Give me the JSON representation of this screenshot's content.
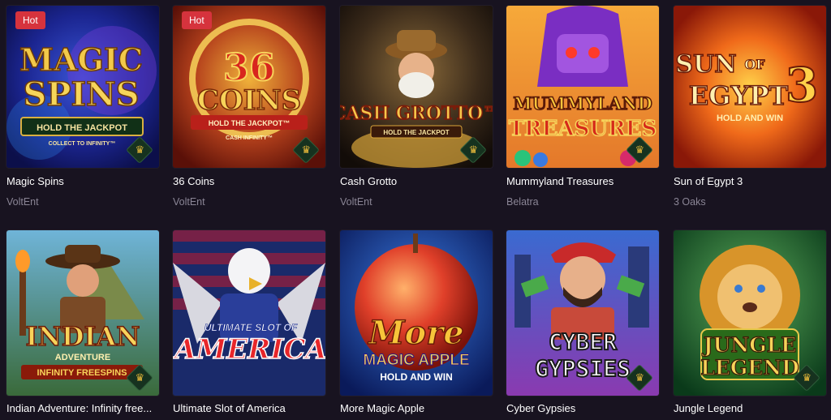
{
  "colors": {
    "background": "#181320",
    "hot_badge": "#d6333d",
    "provider_text": "#8a8595"
  },
  "games": [
    {
      "title": "Magic Spins",
      "provider": "VoltEnt",
      "badge": "Hot",
      "logo_lines": [
        "MAGIC",
        "SPINS"
      ],
      "sub_lines": [
        "HOLD THE JACKPOT",
        "COLLECT TO INFINITY™"
      ],
      "trophy": "trophy-icon"
    },
    {
      "title": "36 Coins",
      "provider": "VoltEnt",
      "badge": "Hot",
      "logo_lines": [
        "36",
        "COINS"
      ],
      "sub_lines": [
        "HOLD THE JACKPOT™",
        "CASH INFINITY™"
      ],
      "trophy": "trophy-icon"
    },
    {
      "title": "Cash Grotto",
      "provider": "VoltEnt",
      "badge": "",
      "logo_lines": [
        "CASH GROTTO™"
      ],
      "sub_lines": [
        "HOLD THE JACKPOT"
      ],
      "trophy": "trophy-icon"
    },
    {
      "title": "Mummyland Treasures",
      "provider": "Belatra",
      "badge": "",
      "logo_lines": [
        "MUMMYLAND",
        "TREASURES"
      ],
      "sub_lines": [],
      "trophy": "trophy-icon"
    },
    {
      "title": "Sun of Egypt 3",
      "provider": "3 Oaks",
      "badge": "",
      "logo_lines": [
        "SUN",
        "OF",
        "EGYPT",
        "3"
      ],
      "sub_lines": [
        "HOLD AND WIN"
      ],
      "trophy": ""
    },
    {
      "title": "Indian Adventure: Infinity free...",
      "provider": "",
      "badge": "",
      "logo_lines": [
        "INDIAN",
        "ADVENTURE"
      ],
      "sub_lines": [
        "INFINITY FREESPINS"
      ],
      "trophy": "trophy-icon"
    },
    {
      "title": "Ultimate Slot of America",
      "provider": "",
      "badge": "",
      "logo_lines": [
        "ULTIMATE SLOT OF",
        "AMERICA"
      ],
      "sub_lines": [],
      "trophy": ""
    },
    {
      "title": "More Magic Apple",
      "provider": "",
      "badge": "",
      "logo_lines": [
        "More",
        "MAGIC APPLE"
      ],
      "sub_lines": [
        "HOLD AND WIN"
      ],
      "trophy": ""
    },
    {
      "title": "Cyber Gypsies",
      "provider": "",
      "badge": "",
      "logo_lines": [
        "CYBER",
        "GYPSIES"
      ],
      "sub_lines": [],
      "trophy": "trophy-icon"
    },
    {
      "title": "Jungle Legend",
      "provider": "",
      "badge": "",
      "logo_lines": [
        "JUNGLE",
        "LEGEND"
      ],
      "sub_lines": [],
      "trophy": "trophy-icon"
    }
  ]
}
